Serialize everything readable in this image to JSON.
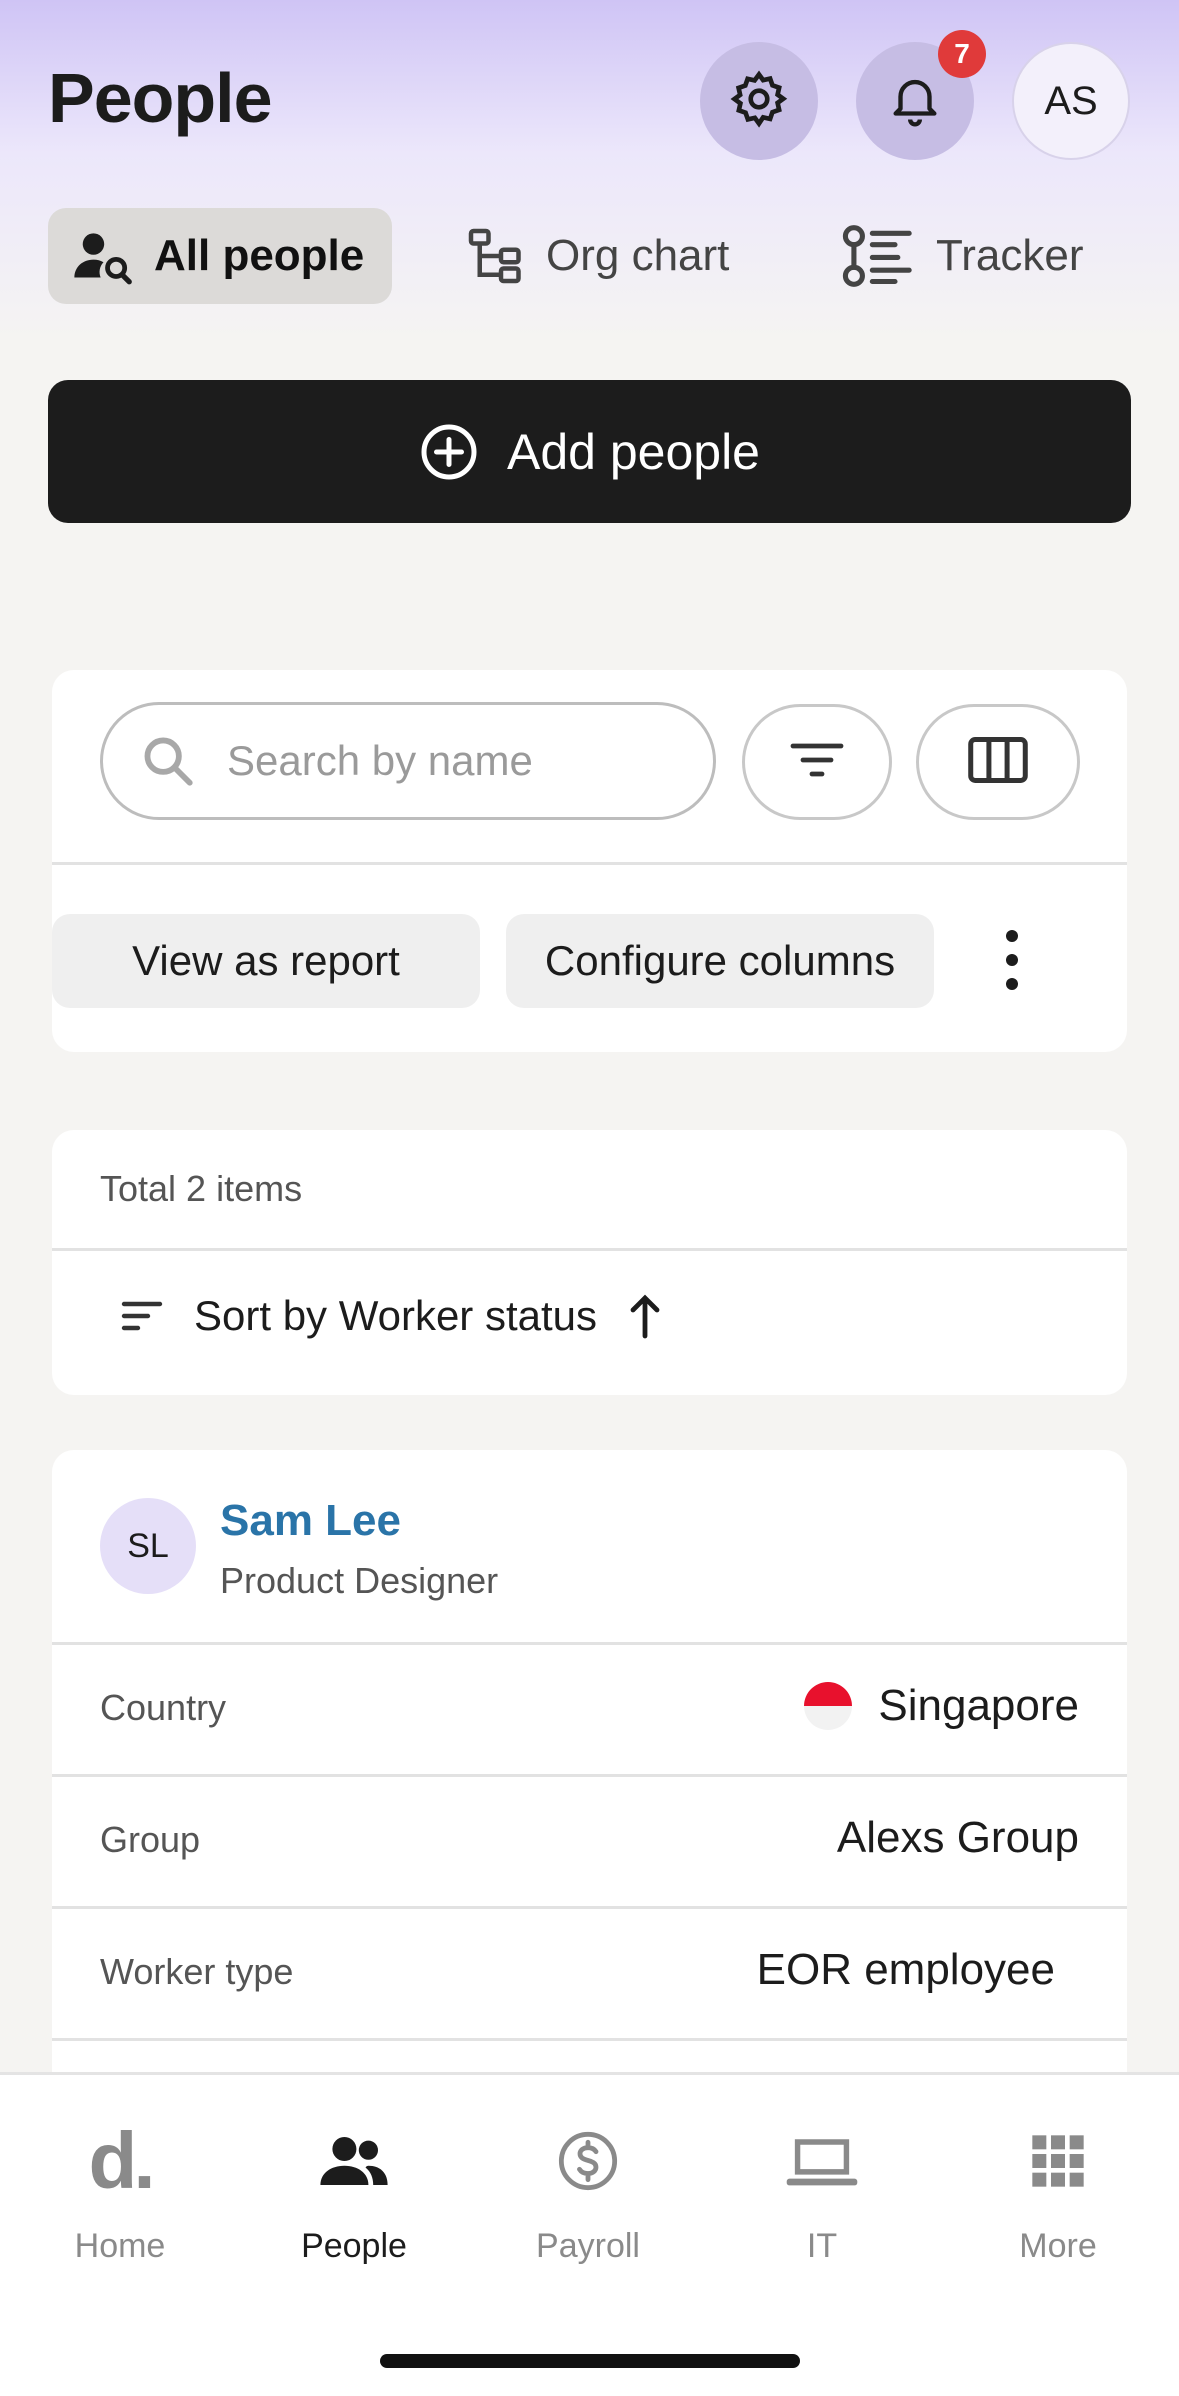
{
  "header": {
    "title": "People",
    "notification_count": "7",
    "avatar_initials": "AS"
  },
  "tabs": [
    {
      "label": "All people",
      "active": true
    },
    {
      "label": "Org chart",
      "active": false
    },
    {
      "label": "Tracker",
      "active": false
    }
  ],
  "add_button": {
    "label": "Add people"
  },
  "search": {
    "placeholder": "Search by name"
  },
  "actions": {
    "view_report": "View as report",
    "configure_columns": "Configure columns"
  },
  "list": {
    "total_text": "Total 2 items",
    "sort_label": "Sort by Worker status"
  },
  "person": {
    "initials": "SL",
    "name": "Sam Lee",
    "role": "Product Designer",
    "details": [
      {
        "label": "Country",
        "value": "Singapore"
      },
      {
        "label": "Group",
        "value": "Alexs Group"
      },
      {
        "label": "Worker type",
        "value": "EOR employee"
      }
    ]
  },
  "nav": [
    {
      "label": "Home",
      "icon": "home-logo"
    },
    {
      "label": "People",
      "icon": "people-icon"
    },
    {
      "label": "Payroll",
      "icon": "dollar-icon"
    },
    {
      "label": "IT",
      "icon": "laptop-icon"
    },
    {
      "label": "More",
      "icon": "grid-icon"
    }
  ],
  "colors": {
    "accent_link": "#2a74a8",
    "primary_button": "#1c1c1c",
    "badge": "#e03a3a",
    "header_gradient": "#cfc4f5"
  }
}
